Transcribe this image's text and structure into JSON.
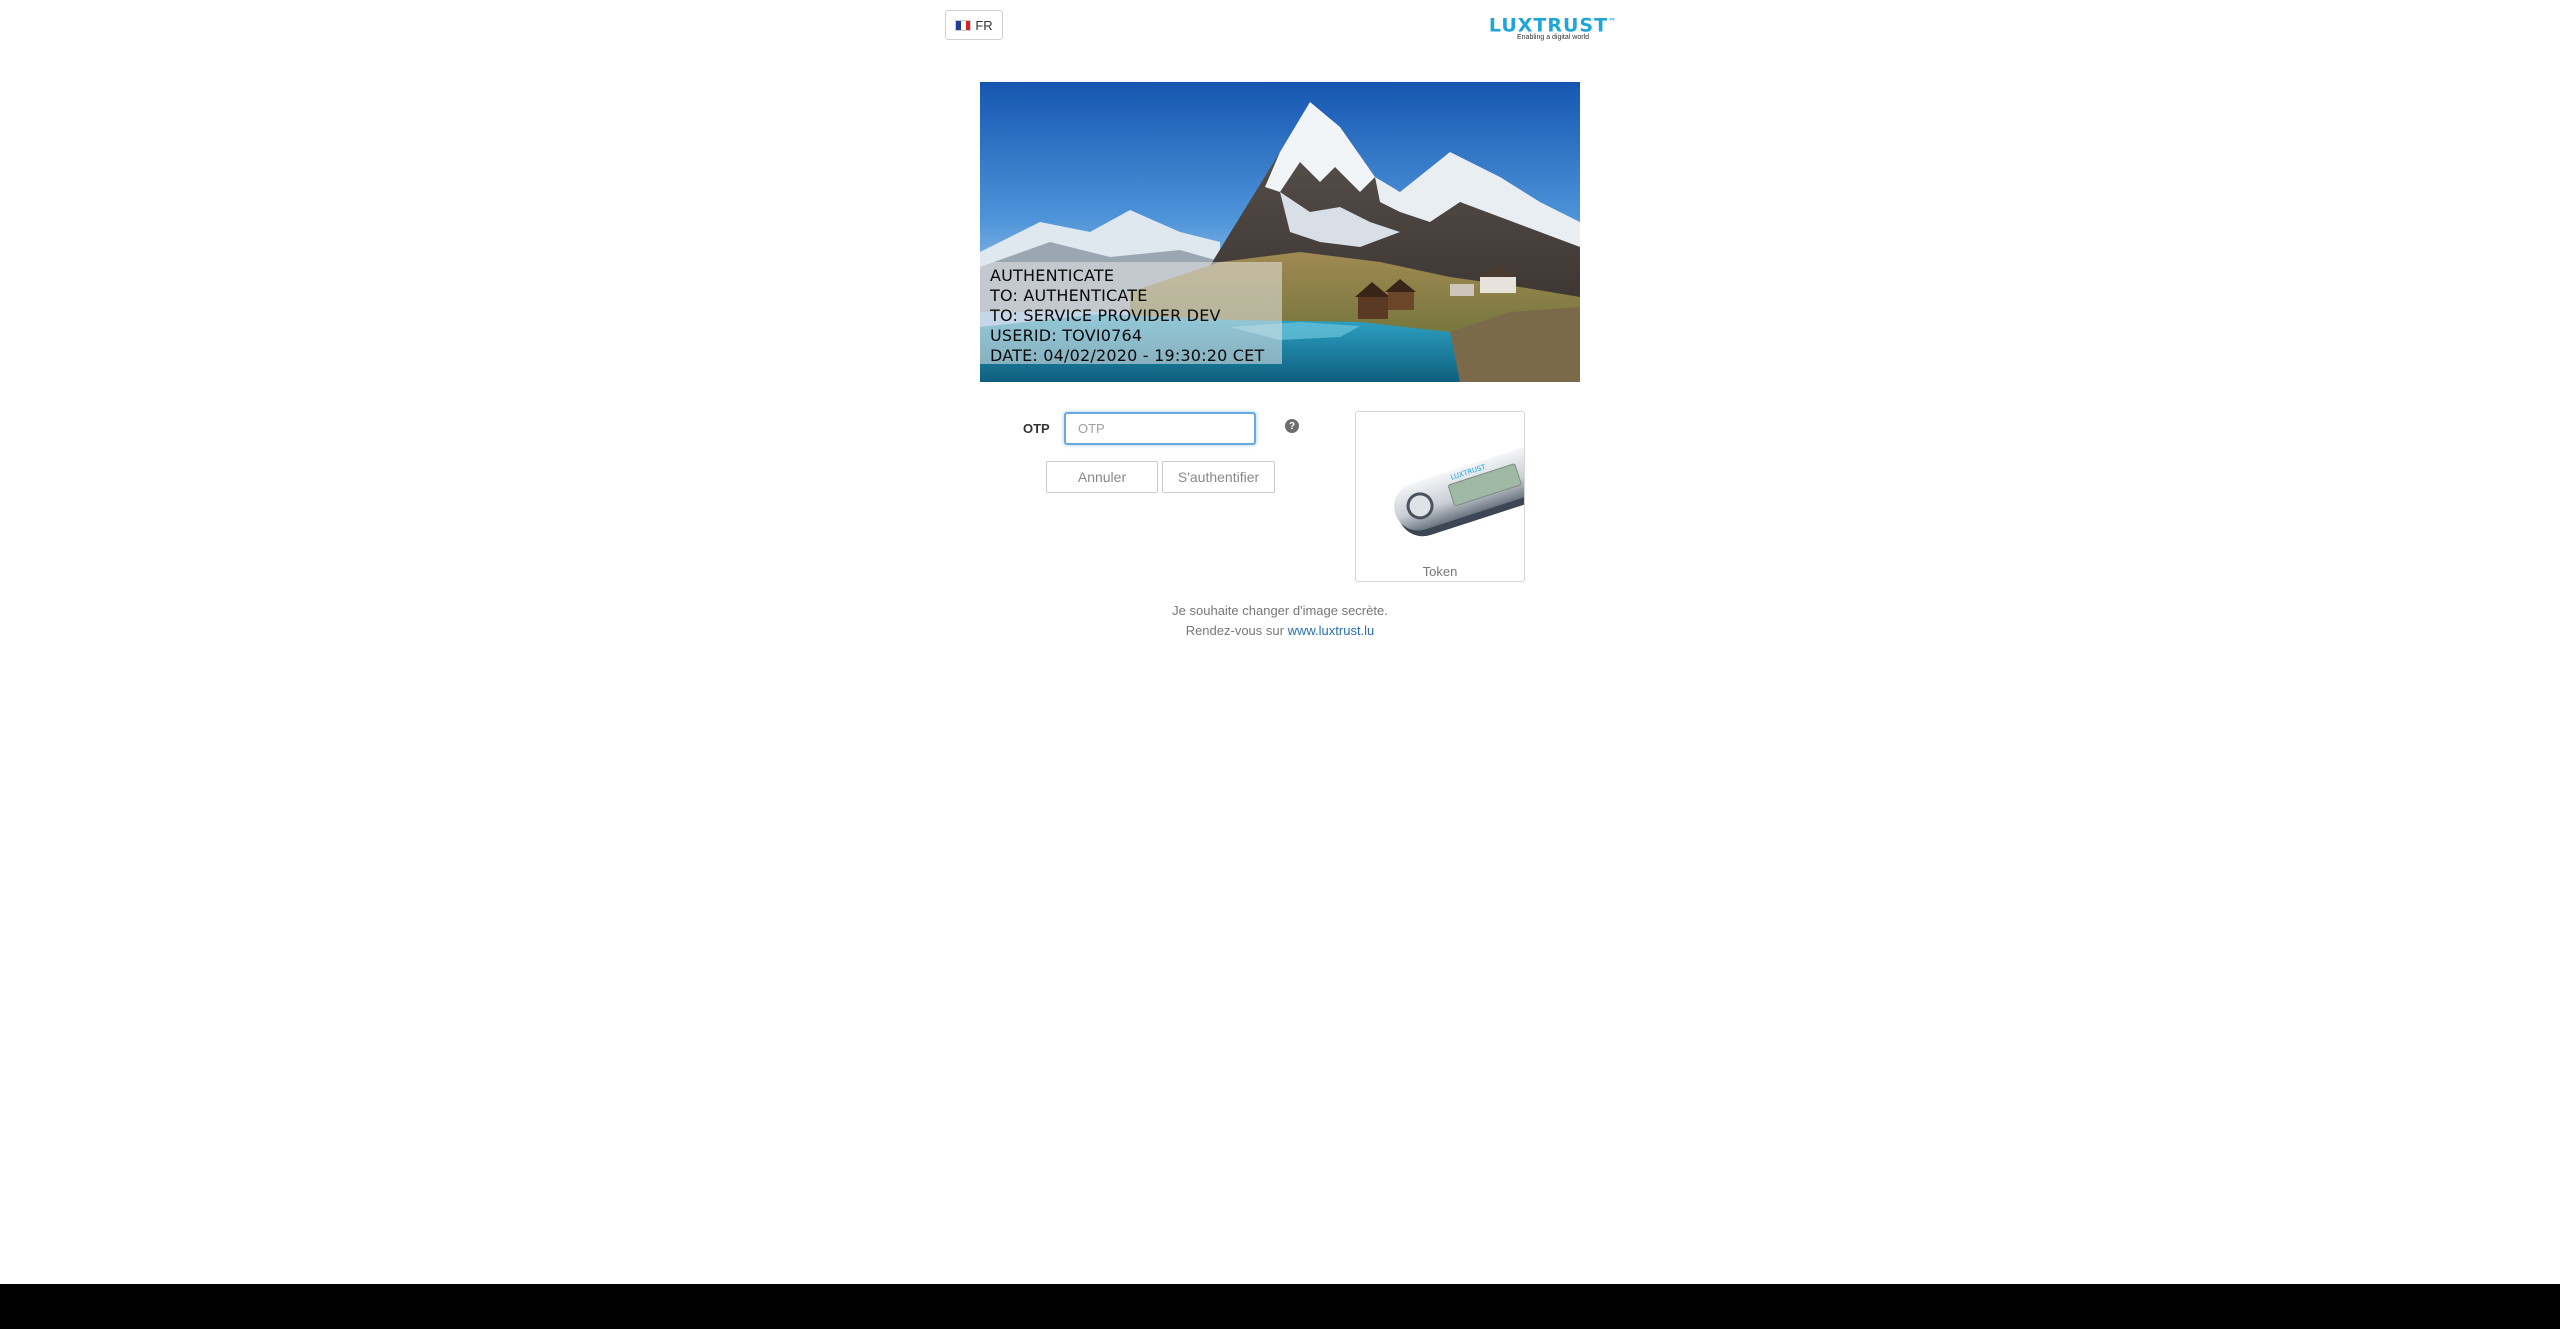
{
  "language": {
    "current": "FR"
  },
  "logo": {
    "brand": "LUXTRUST",
    "tagline": "Enabling a digital world"
  },
  "secret_image": {
    "lines": [
      "AUTHENTICATE",
      "TO: AUTHENTICATE",
      "TO: SERVICE PROVIDER DEV",
      "USERID: TOVI0764",
      "DATE: 04/02/2020 - 19:30:20 CET"
    ]
  },
  "form": {
    "otp_label": "OTP",
    "otp_placeholder": "OTP",
    "otp_value": "",
    "cancel_label": "Annuler",
    "auth_label": "S'authentifier"
  },
  "token": {
    "label": "Token"
  },
  "footer": {
    "change_text": "Je souhaite changer d'image secrète.",
    "goto_prefix": "Rendez-vous sur",
    "goto_link": "www.luxtrust.lu"
  },
  "colors": {
    "brand": "#1ea5d9",
    "link": "#2a6fa8",
    "input_focus": "#6aa8e0"
  }
}
